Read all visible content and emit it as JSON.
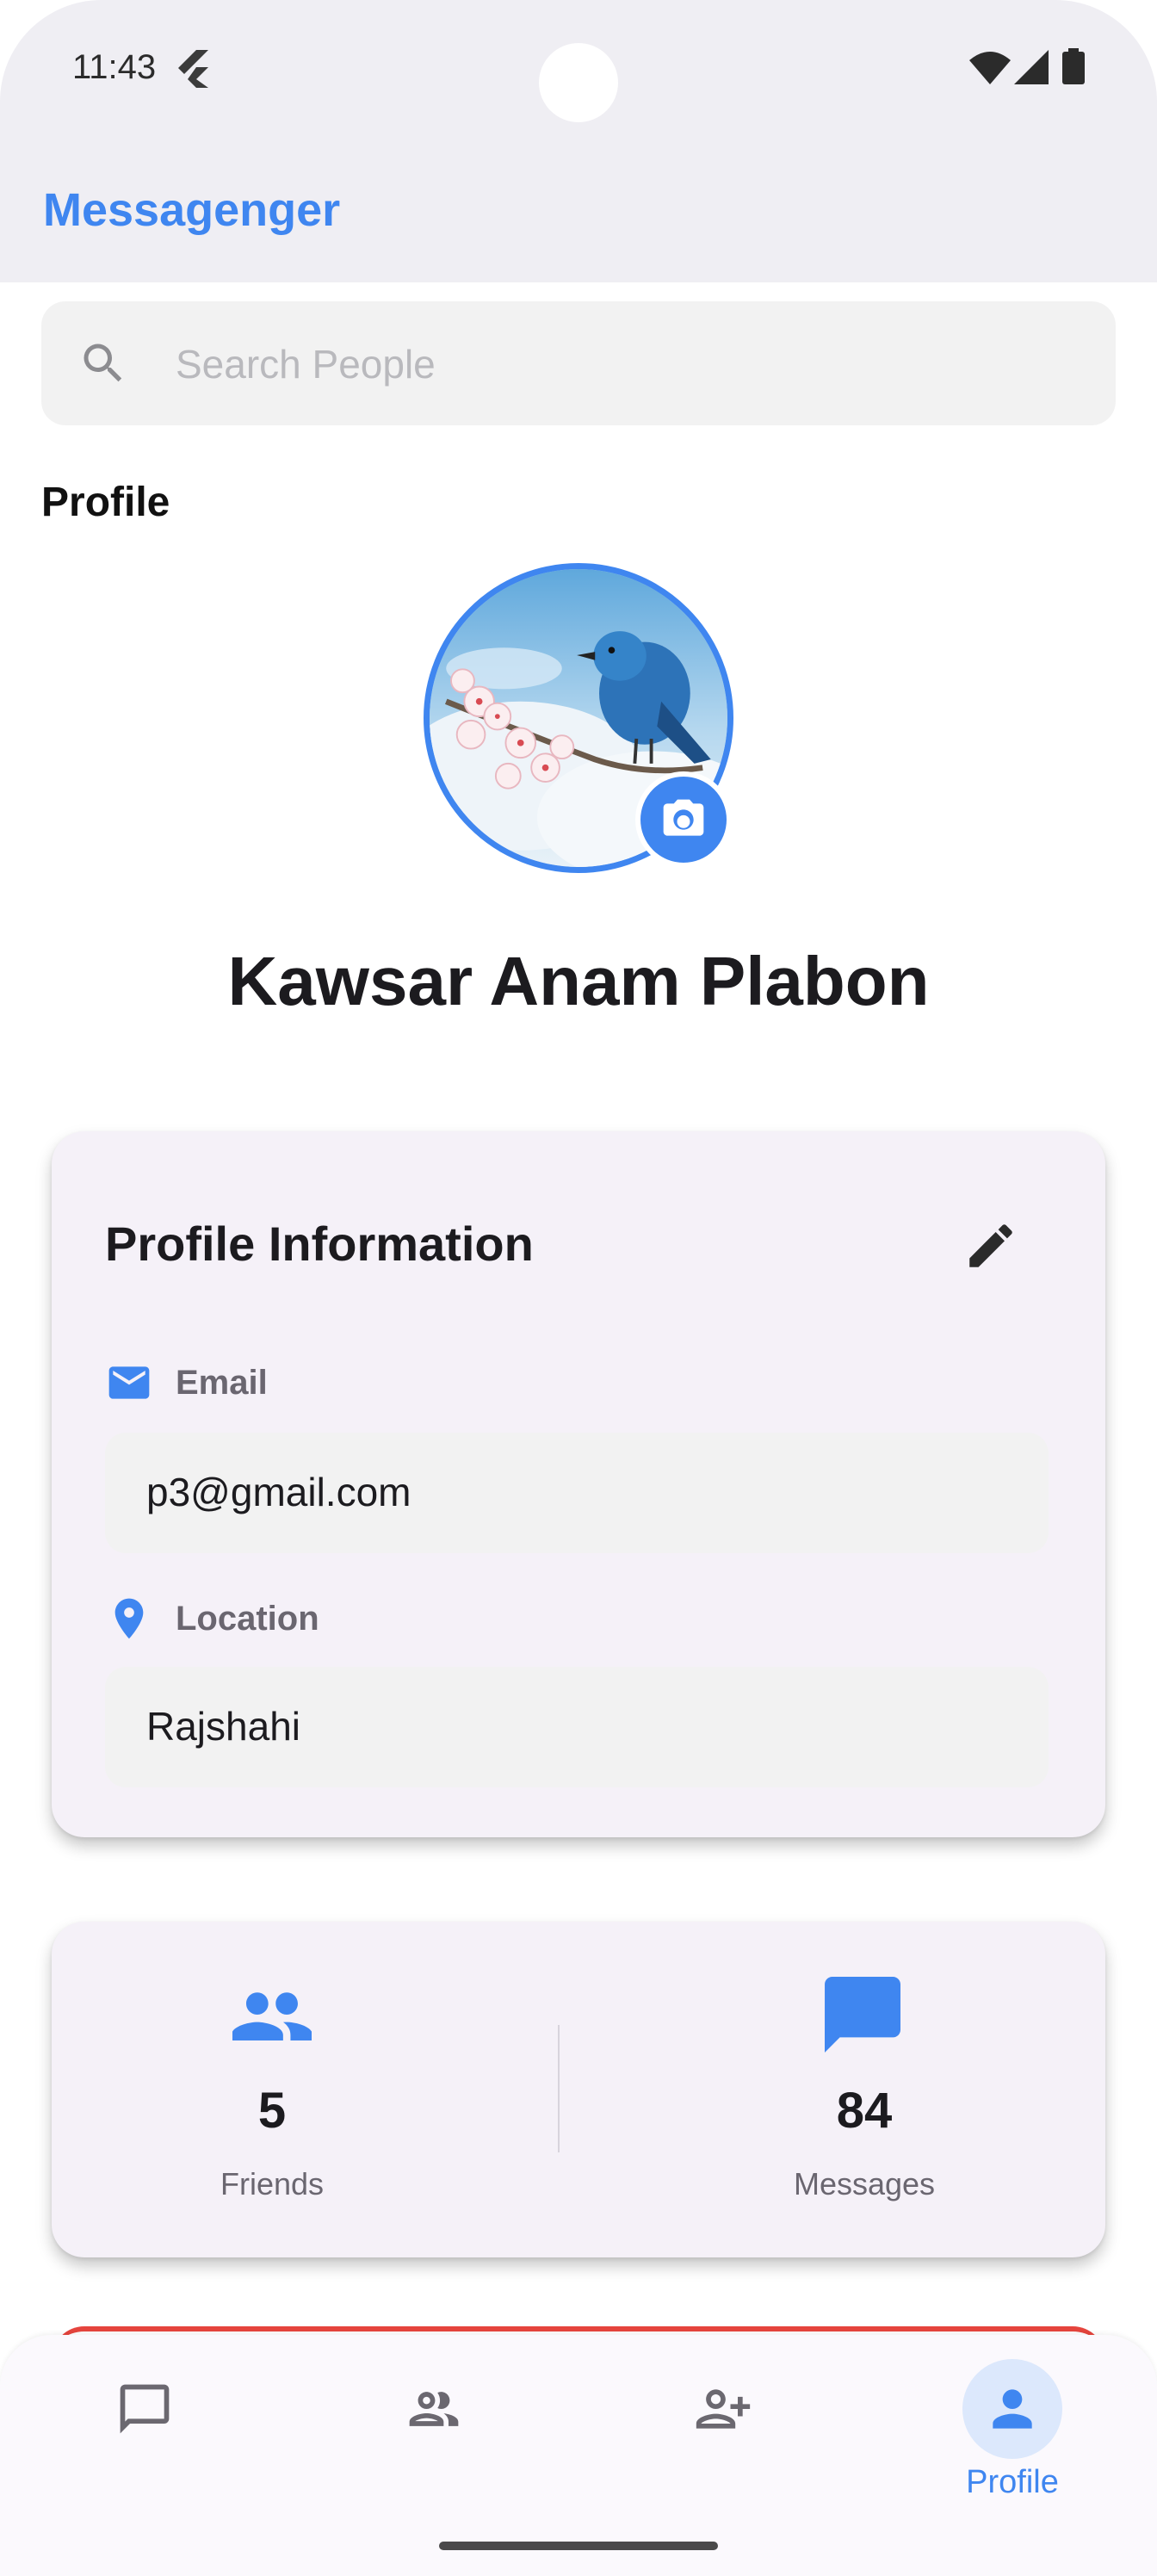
{
  "status_bar": {
    "time": "11:43",
    "icons": [
      "flutter-icon",
      "wifi-icon",
      "signal-icon",
      "battery-icon"
    ]
  },
  "app_bar": {
    "title": "Messagenger"
  },
  "search": {
    "placeholder": "Search People",
    "value": "",
    "icon": "search-icon"
  },
  "profile": {
    "section_title": "Profile",
    "name": "Kawsar Anam Plabon",
    "avatar_icon": "camera-icon"
  },
  "info_card": {
    "title": "Profile Information",
    "edit_icon": "edit-icon",
    "email_label": "Email",
    "email_value": "p3@gmail.com",
    "location_label": "Location",
    "location_value": "Rajshahi"
  },
  "stats": {
    "friends_count": "5",
    "friends_label": "Friends",
    "messages_count": "84",
    "messages_label": "Messages"
  },
  "bottom_nav": {
    "items": [
      {
        "icon": "chat-icon",
        "label": "",
        "active": false
      },
      {
        "icon": "people-icon",
        "label": "",
        "active": false
      },
      {
        "icon": "add-person-icon",
        "label": "",
        "active": false
      },
      {
        "icon": "person-icon",
        "label": "Profile",
        "active": true
      }
    ]
  },
  "colors": {
    "accent": "#3f86f0",
    "card_bg": "#f5f1f8",
    "app_bar_bg": "#efeef3",
    "danger": "#e5443d"
  }
}
